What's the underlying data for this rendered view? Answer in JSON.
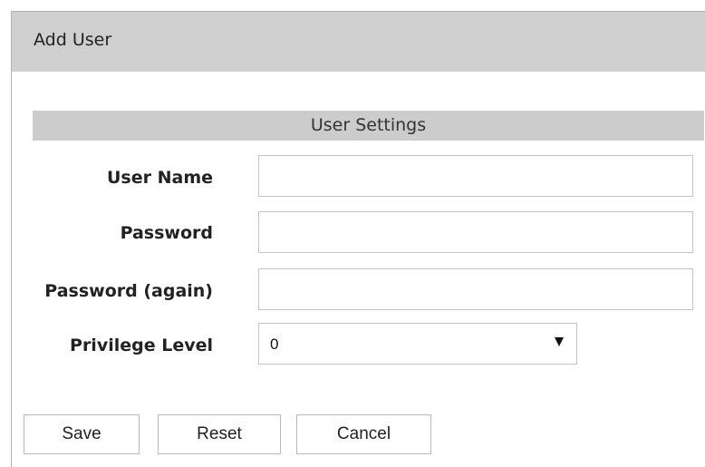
{
  "dialog": {
    "title": "Add User"
  },
  "section": {
    "header": "User Settings"
  },
  "fields": {
    "user_name": {
      "label": "User Name",
      "value": ""
    },
    "password": {
      "label": "Password",
      "value": ""
    },
    "password_again": {
      "label": "Password (again)",
      "value": ""
    },
    "privilege_level": {
      "label": "Privilege Level",
      "selected": "0"
    }
  },
  "buttons": {
    "save": "Save",
    "reset": "Reset",
    "cancel": "Cancel"
  },
  "icons": {
    "dropdown": "chevron-down-icon"
  }
}
